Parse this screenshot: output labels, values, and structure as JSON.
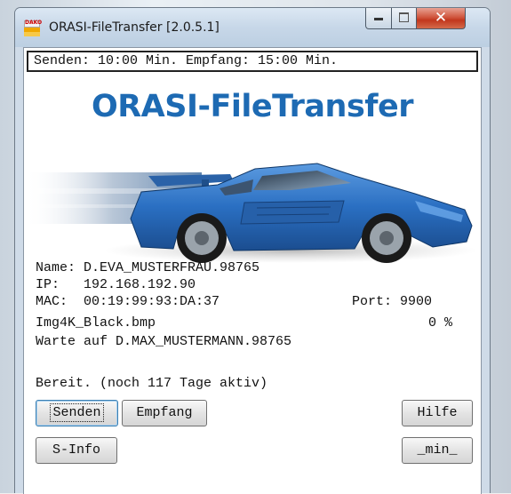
{
  "window": {
    "title": "ORASI-FileTransfer [2.0.5.1]",
    "icon_text": "DAKO",
    "controls": [
      "minimize",
      "maximize",
      "close"
    ]
  },
  "status_line": "Senden: 10:00 Min. Empfang: 15:00 Min.",
  "brand_title": "ORASI-FileTransfer",
  "info": {
    "name_label": "Name:",
    "name_value": "D.EVA_MUSTERFRAU.98765",
    "ip_label": "IP:",
    "ip_value": "192.168.192.90",
    "mac_label": "MAC:",
    "mac_value": "00:19:99:93:DA:37",
    "port_label": "Port:",
    "port_value": "9900",
    "file_name": "Img4K_Black.bmp",
    "progress_text": "0 %",
    "progress": 0,
    "waiting_text": "Warte auf D.MAX_MUSTERMANN.98765",
    "ready_text": "Bereit. (noch 117 Tage aktiv)"
  },
  "buttons": {
    "send": "Senden",
    "receive": "Empfang",
    "help": "Hilfe",
    "sinfo": "S-Info",
    "minimize": "_min_"
  },
  "colors": {
    "brand": "#1d6ab3",
    "car": "#2a6fc2",
    "close_button": "#c2371d"
  }
}
